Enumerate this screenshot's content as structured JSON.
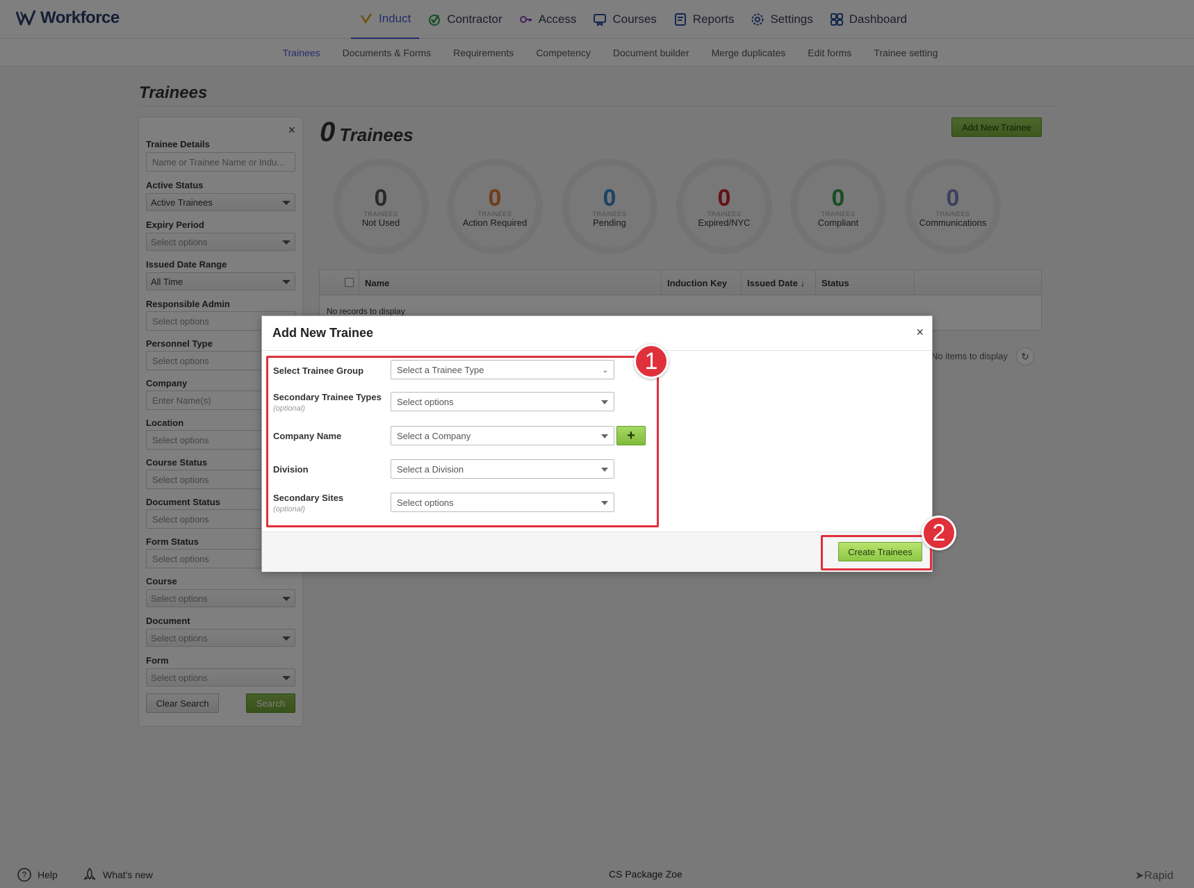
{
  "app": {
    "name": "Workforce"
  },
  "nav": {
    "items": [
      {
        "label": "Induct",
        "active": true,
        "icon": "induct-check-icon",
        "color": "#d9a21b"
      },
      {
        "label": "Contractor",
        "active": false,
        "icon": "contractor-check-icon",
        "color": "#2e9a4a"
      },
      {
        "label": "Access",
        "active": false,
        "icon": "key-icon",
        "color": "#8a3fb8"
      },
      {
        "label": "Courses",
        "active": false,
        "icon": "courses-icon",
        "color": "#2b4f9a"
      },
      {
        "label": "Reports",
        "active": false,
        "icon": "reports-icon",
        "color": "#2b4f9a"
      },
      {
        "label": "Settings",
        "active": false,
        "icon": "gear-icon",
        "color": "#2b4f9a"
      },
      {
        "label": "Dashboard",
        "active": false,
        "icon": "dashboard-grid-icon",
        "color": "#2b4f9a"
      }
    ]
  },
  "subnav": {
    "items": [
      {
        "label": "Trainees",
        "active": true
      },
      {
        "label": "Documents & Forms",
        "active": false
      },
      {
        "label": "Requirements",
        "active": false
      },
      {
        "label": "Competency",
        "active": false
      },
      {
        "label": "Document builder",
        "active": false
      },
      {
        "label": "Merge duplicates",
        "active": false
      },
      {
        "label": "Edit forms",
        "active": false
      },
      {
        "label": "Trainee setting",
        "active": false
      }
    ]
  },
  "page": {
    "title": "Trainees"
  },
  "filter": {
    "trainee_details": {
      "label": "Trainee Details",
      "placeholder": "Name or Trainee Name or Indu..."
    },
    "active_status": {
      "label": "Active Status",
      "value": "Active Trainees"
    },
    "expiry_period": {
      "label": "Expiry Period",
      "placeholder": "Select options"
    },
    "issued_date_range": {
      "label": "Issued Date Range",
      "value": "All Time"
    },
    "responsible_admin": {
      "label": "Responsible Admin",
      "placeholder": "Select options"
    },
    "personnel_type": {
      "label": "Personnel Type",
      "placeholder": "Select options"
    },
    "company": {
      "label": "Company",
      "placeholder": "Enter Name(s)"
    },
    "location": {
      "label": "Location",
      "placeholder": "Select options"
    },
    "course_status": {
      "label": "Course Status",
      "placeholder": "Select options"
    },
    "document_status": {
      "label": "Document Status",
      "placeholder": "Select options"
    },
    "form_status": {
      "label": "Form Status",
      "placeholder": "Select options"
    },
    "course": {
      "label": "Course",
      "placeholder": "Select options"
    },
    "document": {
      "label": "Document",
      "placeholder": "Select options"
    },
    "form": {
      "label": "Form",
      "placeholder": "Select options"
    },
    "clear_label": "Clear Search",
    "search_label": "Search",
    "close_glyph": "×"
  },
  "summary": {
    "count": "0",
    "label": "Trainees",
    "add_button": "Add New Trainee",
    "circles": [
      {
        "value": "0",
        "caption": "TRAINEES",
        "label": "Not Used",
        "color": "#555555"
      },
      {
        "value": "0",
        "caption": "TRAINEES",
        "label": "Action Required",
        "color": "#e07b2e"
      },
      {
        "value": "0",
        "caption": "TRAINEES",
        "label": "Pending",
        "color": "#3a86c8"
      },
      {
        "value": "0",
        "caption": "TRAINEES",
        "label": "Expired/NYC",
        "color": "#c8242b"
      },
      {
        "value": "0",
        "caption": "TRAINEES",
        "label": "Compliant",
        "color": "#2e9a4a"
      },
      {
        "value": "0",
        "caption": "TRAINEES",
        "label": "Communications",
        "color": "#7e7fbf"
      }
    ]
  },
  "grid": {
    "columns": [
      "Name",
      "Induction Key",
      "Issued Date ↓",
      "Status"
    ],
    "empty": "No records to display",
    "pager": "No items to display",
    "refresh_glyph": "↻"
  },
  "modal": {
    "title": "Add New Trainee",
    "close_glyph": "×",
    "fields": {
      "trainee_group": {
        "label": "Select Trainee Group",
        "placeholder": "Select a Trainee Type"
      },
      "secondary_types": {
        "label": "Secondary Trainee Types",
        "optional": "(optional)",
        "placeholder": "Select options"
      },
      "company": {
        "label": "Company Name",
        "placeholder": "Select a Company"
      },
      "division": {
        "label": "Division",
        "placeholder": "Select a Division"
      },
      "secondary_sites": {
        "label": "Secondary Sites",
        "optional": "(optional)",
        "placeholder": "Select options"
      }
    },
    "add_company_glyph": "+",
    "create_label": "Create Trainees"
  },
  "annotations": {
    "badge1": "1",
    "badge2": "2",
    "color": "#e0303b"
  },
  "footer": {
    "help": "Help",
    "whats_new": "What's new",
    "center": "CS Package Zoe",
    "brand": "Rapid"
  }
}
